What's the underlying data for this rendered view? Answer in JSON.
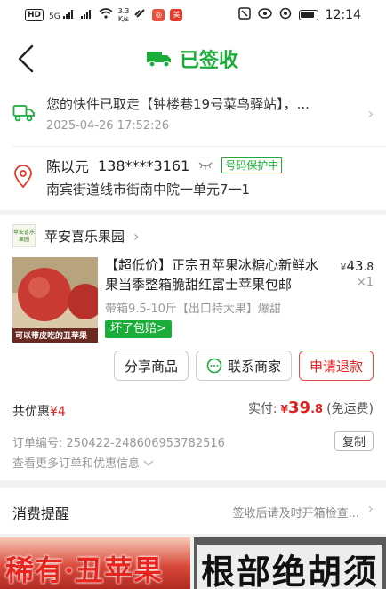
{
  "status_bar": {
    "hd": "HD",
    "signal_left": "5G",
    "net_speed": "3.3",
    "net_unit": "K/s",
    "time": "12:14"
  },
  "header": {
    "title": "已签收"
  },
  "logistics": {
    "text": "您的快件已取走【钟楼巷19号菜鸟驿站】，...",
    "time": "2025-04-26 17:52:26"
  },
  "address": {
    "name": "陈以元",
    "phone": "138****3161",
    "protect_tag": "号码保护中",
    "detail": "南宾街道线市街南中院一单元7一1"
  },
  "store": {
    "logo_text": "苹安喜乐果园",
    "name": "苹安喜乐果园"
  },
  "product": {
    "title": "【超低价】正宗丑苹果冰糖心新鲜水果当季整箱脆甜红富士苹果包邮",
    "spec": "带箱9.5-10斤【出口特大果】爆甜",
    "badge": "坏了包赔>",
    "price_currency": "¥",
    "price_int": "43",
    "price_dec": ".8",
    "quantity": "×1",
    "image_caption": "可以带皮吃的丑苹果"
  },
  "actions": {
    "share": "分享商品",
    "contact": "联系商家",
    "refund": "申请退款"
  },
  "summary": {
    "discount_label": "共优惠",
    "discount_value": "¥4",
    "paid_label": "实付:",
    "paid_currency": "¥",
    "paid_int": "39",
    "paid_dec": ".8",
    "paid_note": "(免运费)"
  },
  "order": {
    "number_label": "订单编号:",
    "number": "250422-248606953782516",
    "copy": "复制",
    "more": "查看更多订单和优惠信息"
  },
  "reminder": {
    "title": "消费提醒",
    "text": "签收后请及时开箱检查..."
  },
  "banners": {
    "left": "稀有·丑苹果",
    "right": "根部绝胡须"
  },
  "colors": {
    "accent_green": "#1aad3a",
    "accent_red": "#e02020"
  }
}
